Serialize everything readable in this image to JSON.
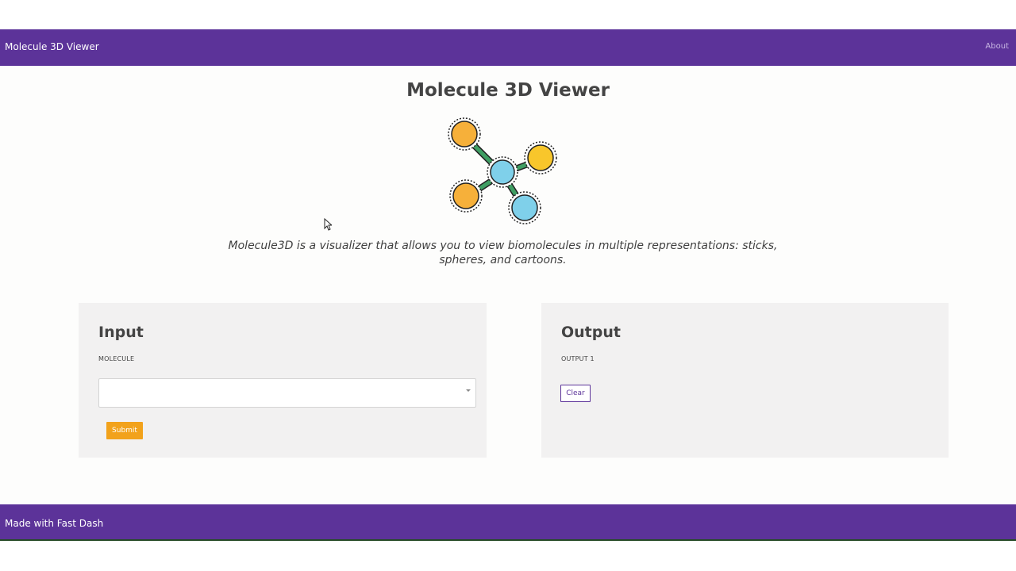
{
  "navbar": {
    "brand": "Molecule 3D Viewer",
    "about_label": "About",
    "color": "#5c3399"
  },
  "main": {
    "title": "Molecule 3D Viewer",
    "logo_icon": "molecule-icon",
    "description": "Molecule3D is a visualizer that allows you to view biomolecules in multiple representations: sticks, spheres, and cartoons."
  },
  "input_panel": {
    "title": "Input",
    "field_label": "MOLECULE",
    "select_value": "",
    "dropdown_icon": "caret-down-icon",
    "submit_label": "Submit",
    "submit_color": "#f2a21b"
  },
  "output_panel": {
    "title": "Output",
    "field_label": "OUTPUT 1",
    "clear_label": "Clear"
  },
  "footer": {
    "text": "Made with Fast Dash"
  }
}
